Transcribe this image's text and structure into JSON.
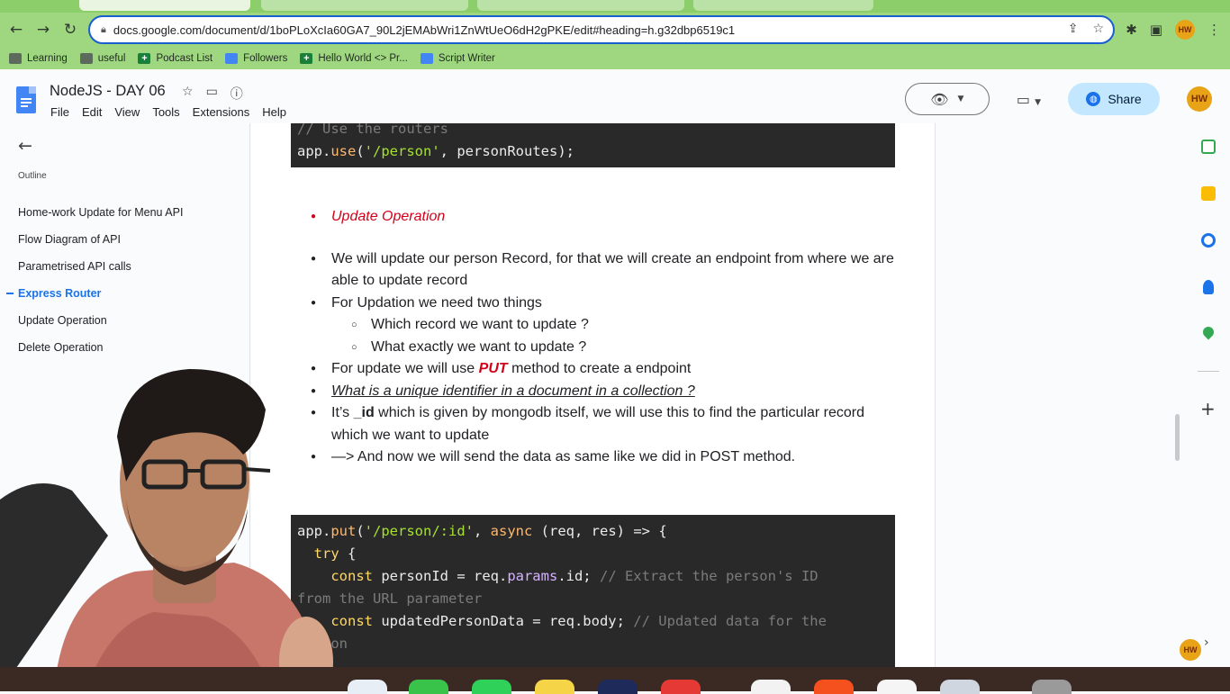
{
  "browser": {
    "url": "docs.google.com/document/d/1boPLoXcIa60GA7_90L2jEMAbWri1ZnWtUeO6dH2gPKE/edit#heading=h.g32dbp6519c1",
    "profile_initials": "HW"
  },
  "bookmarks": [
    {
      "label": "Learning",
      "icon": "folder-icon"
    },
    {
      "label": "useful",
      "icon": "folder-icon"
    },
    {
      "label": "Podcast List",
      "icon": "sheets-icon"
    },
    {
      "label": "Followers",
      "icon": "docs-icon"
    },
    {
      "label": "Hello World <> Pr...",
      "icon": "sheets-icon"
    },
    {
      "label": "Script Writer",
      "icon": "docs-icon"
    }
  ],
  "docs": {
    "title": "NodeJS - DAY 06",
    "menu": [
      "File",
      "Edit",
      "View",
      "Tools",
      "Extensions",
      "Help"
    ],
    "share_label": "Share",
    "avatar_initials": "HW"
  },
  "outline": {
    "label": "Outline",
    "items": [
      {
        "label": "Home-work Update for Menu API",
        "active": false
      },
      {
        "label": "Flow Diagram of API",
        "active": false
      },
      {
        "label": "Parametrised API calls",
        "active": false
      },
      {
        "label": "Express Router",
        "active": true
      },
      {
        "label": "Update Operation",
        "active": false
      },
      {
        "label": "Delete Operation",
        "active": false
      }
    ]
  },
  "content": {
    "code_top": {
      "comment": "// Use the routers",
      "l1_a": "app.",
      "l1_fn": "use",
      "l1_b": "(",
      "l1_str": "'/person'",
      "l1_c": ", personRoutes);"
    },
    "heading": "Update Operation",
    "b1": "We will update our person Record, for that we will create an endpoint from where we are able to update record",
    "b2": "For Updation we need two things",
    "b2_sub1": "Which record we want to update ?",
    "b2_sub2": "What exactly we want to update ?",
    "b3_pre": "For update we will use ",
    "b3_put": "PUT",
    "b3_post": " method to create a endpoint",
    "b4": "What is a unique identifier in a document in a collection ?",
    "b5_pre": "It’s ",
    "b5_id": "_id",
    "b5_post": " which is given by mongodb itself, we will use this to find the particular record which we want to update",
    "b6": "—> And now we will send the data as same like we did in POST method.",
    "code_bottom": {
      "l1_a": "app.",
      "l1_fn": "put",
      "l1_b": "(",
      "l1_str": "'/person/:id'",
      "l1_c": ", ",
      "l1_kw": "async",
      "l1_d": " (req, res) => {",
      "l2_kw": "try",
      "l2_b": " {",
      "l3_kw": "const",
      "l3_a": " personId = req.",
      "l3_prop": "params",
      "l3_b": ".id; ",
      "l3_cm": "// Extract the person's ID",
      "l4_cm": "from the URL parameter",
      "l5_kw": "const",
      "l5_a": " updatedPersonData = req.body; ",
      "l5_cm": "// Updated data for the",
      "l6_cm": "person"
    }
  },
  "colors": {
    "chrome_green": "#9fd780",
    "code_bg": "#292929",
    "heading_red": "#d0021b",
    "link_blue": "#1a73e8",
    "share_bg": "#c2e7ff"
  }
}
